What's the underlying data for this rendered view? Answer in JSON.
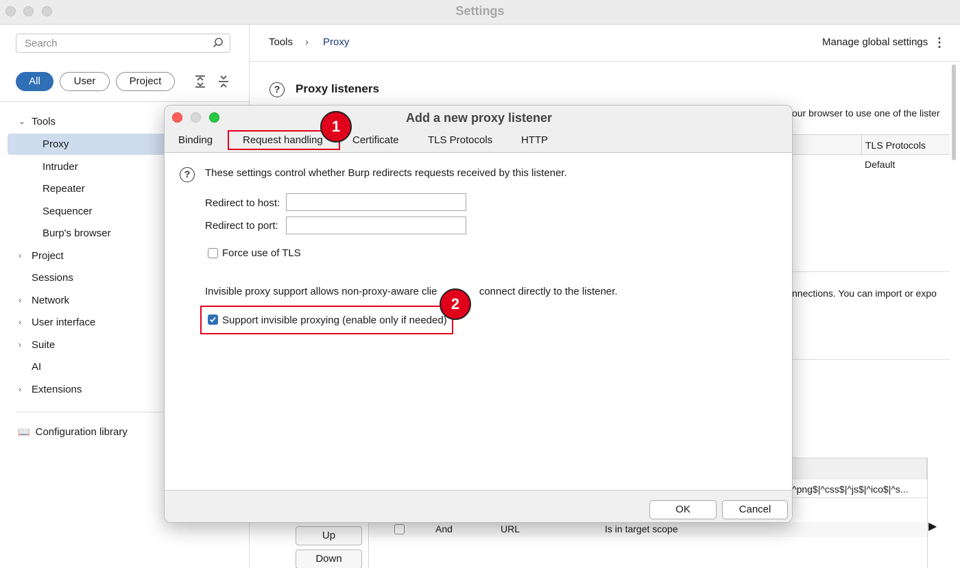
{
  "window": {
    "title": "Settings"
  },
  "sidebar": {
    "search_placeholder": "Search",
    "filters": [
      "All",
      "User",
      "Project"
    ],
    "tree": [
      {
        "label": "Tools",
        "expandable": true,
        "expanded": true
      },
      {
        "label": "Proxy",
        "child": true,
        "selected": true
      },
      {
        "label": "Intruder",
        "child": true
      },
      {
        "label": "Repeater",
        "child": true
      },
      {
        "label": "Sequencer",
        "child": true
      },
      {
        "label": "Burp's browser",
        "child": true
      },
      {
        "label": "Project",
        "expandable": true
      },
      {
        "label": "Sessions"
      },
      {
        "label": "Network",
        "expandable": true
      },
      {
        "label": "User interface",
        "expandable": true
      },
      {
        "label": "Suite",
        "expandable": true
      },
      {
        "label": "AI"
      },
      {
        "label": "Extensions",
        "expandable": true
      }
    ],
    "config_library": "Configuration library"
  },
  "content": {
    "breadcrumb": {
      "root": "Tools",
      "current": "Proxy"
    },
    "manage_global": "Manage global settings",
    "section_title": "Proxy listeners",
    "bg_text_1": "our browser to use one of the lister",
    "bg_text_2": "nnections. You can import or expo",
    "bg_table_header": "TLS Protocols",
    "bg_table_value": "Default",
    "bg_rule_text": "^png$|^css$|^js$|^ico$|^s...",
    "bg_row": {
      "op": "And",
      "match_type": "URL",
      "relationship": "Is in target scope"
    },
    "buttons": {
      "up": "Up",
      "down": "Down"
    }
  },
  "dialog": {
    "title": "Add a new proxy listener",
    "tabs": [
      "Binding",
      "Request handling",
      "Certificate",
      "TLS Protocols",
      "HTTP"
    ],
    "active_tab": "Request handling",
    "intro": "These settings control whether Burp redirects requests received by this listener.",
    "redirect_host_label": "Redirect to host:",
    "redirect_host_value": "",
    "redirect_port_label": "Redirect to port:",
    "redirect_port_value": "",
    "force_tls_label": "Force use of TLS",
    "force_tls_checked": false,
    "invisible_intro": "Invisible proxy support allows non-proxy-aware clie",
    "invisible_intro_tail": "connect directly to the listener.",
    "invisible_label": "Support invisible proxying (enable only if needed)",
    "invisible_checked": true,
    "ok": "OK",
    "cancel": "Cancel"
  },
  "annotations": {
    "badge_1": "1",
    "badge_2": "2"
  },
  "colors": {
    "accent": "#2f6fb5",
    "annotation": "#e0001b",
    "selected_row": "#cfdcee"
  }
}
